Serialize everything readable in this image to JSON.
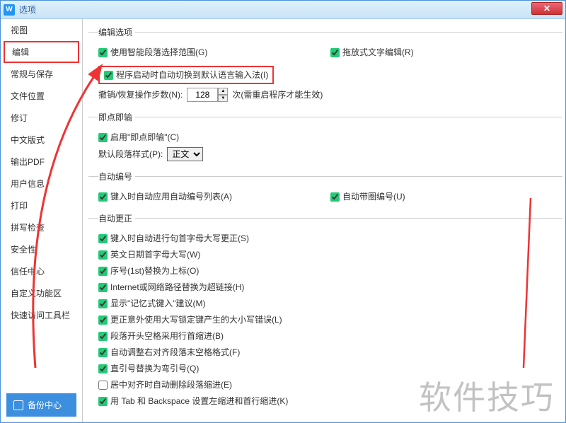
{
  "window": {
    "title": "选项"
  },
  "sidebar": {
    "items": [
      "视图",
      "编辑",
      "常规与保存",
      "文件位置",
      "修订",
      "中文版式",
      "输出PDF",
      "用户信息",
      "打印",
      "拼写检查",
      "安全性",
      "信任中心",
      "自定义功能区",
      "快速访问工具栏"
    ],
    "active_index": 1,
    "backup_label": "备份中心"
  },
  "sections": {
    "edit_options": {
      "title": "编辑选项",
      "smart_range": "使用智能段落选择范围(G)",
      "drag_edit": "拖放式文字编辑(R)",
      "auto_switch_ime": "程序启动时自动切换到默认语言输入法(I)",
      "undo_label_prefix": "撤销/恢复操作步数(N):",
      "undo_value": "128",
      "undo_label_suffix": "次(需重启程序才能生效)"
    },
    "click_type": {
      "title": "即点即输",
      "enable": "启用\"即点即输\"(C)",
      "default_style_label": "默认段落样式(P):",
      "default_style_value": "正文"
    },
    "auto_number": {
      "title": "自动编号",
      "apply_list": "键入时自动应用自动编号列表(A)",
      "circle_number": "自动带圈编号(U)"
    },
    "auto_correct": {
      "title": "自动更正",
      "items": [
        {
          "label": "键入时自动进行句首字母大写更正(S)",
          "checked": true
        },
        {
          "label": "英文日期首字母大写(W)",
          "checked": true
        },
        {
          "label": "序号(1st)替换为上标(O)",
          "checked": true
        },
        {
          "label": "Internet或网络路径替换为超链接(H)",
          "checked": true
        },
        {
          "label": "显示\"记忆式键入\"建议(M)",
          "checked": true
        },
        {
          "label": "更正意外使用大写锁定键产生的大小写错误(L)",
          "checked": true
        },
        {
          "label": "段落开头空格采用行首缩进(B)",
          "checked": true
        },
        {
          "label": "自动调整右对齐段落末空格格式(F)",
          "checked": true
        },
        {
          "label": "直引号替换为弯引号(Q)",
          "checked": true
        },
        {
          "label": "居中对齐时自动删除段落缩进(E)",
          "checked": false
        },
        {
          "label": "用 Tab 和 Backspace 设置左缩进和首行缩进(K)",
          "checked": true
        }
      ]
    }
  },
  "watermark": "软件技巧"
}
